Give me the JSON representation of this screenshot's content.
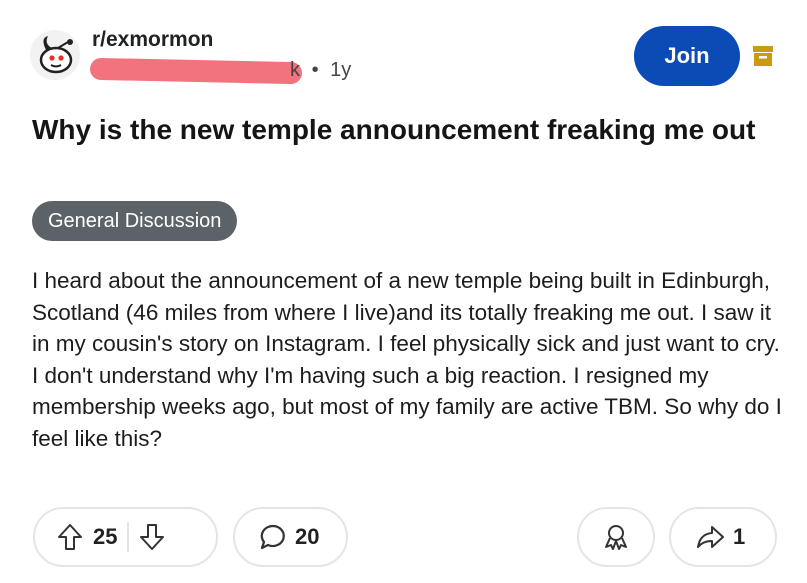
{
  "post": {
    "subreddit": "r/exmormon",
    "meta_suffix": "k",
    "meta_sep": "•",
    "age": "1y",
    "join_label": "Join",
    "title": "Why is the new temple announcement freaking me out",
    "flair": "General Discussion",
    "body": "I heard about the announcement of a new temple being built in Edinburgh, Scotland (46 miles from where I live)and its totally freaking me out. I saw it in my cousin's story on Instagram. I feel physically sick and just want to cry. I don't understand why I'm having such a big reaction. I resigned my membership weeks ago, but most of my family are active TBM. So why do I feel like this?"
  },
  "actions": {
    "score": "25",
    "comments": "20",
    "shares": "1"
  },
  "icons": {
    "upvote": "arrow-up-icon",
    "downvote": "arrow-down-icon",
    "comment": "speech-bubble-icon",
    "award": "award-icon",
    "share": "share-arrow-icon",
    "archive": "archive-box-icon"
  },
  "colors": {
    "join_button": "#0a4bb5",
    "flair_bg": "#5c6368",
    "redaction": "#f2727d",
    "archive_icon": "#c99a12"
  }
}
